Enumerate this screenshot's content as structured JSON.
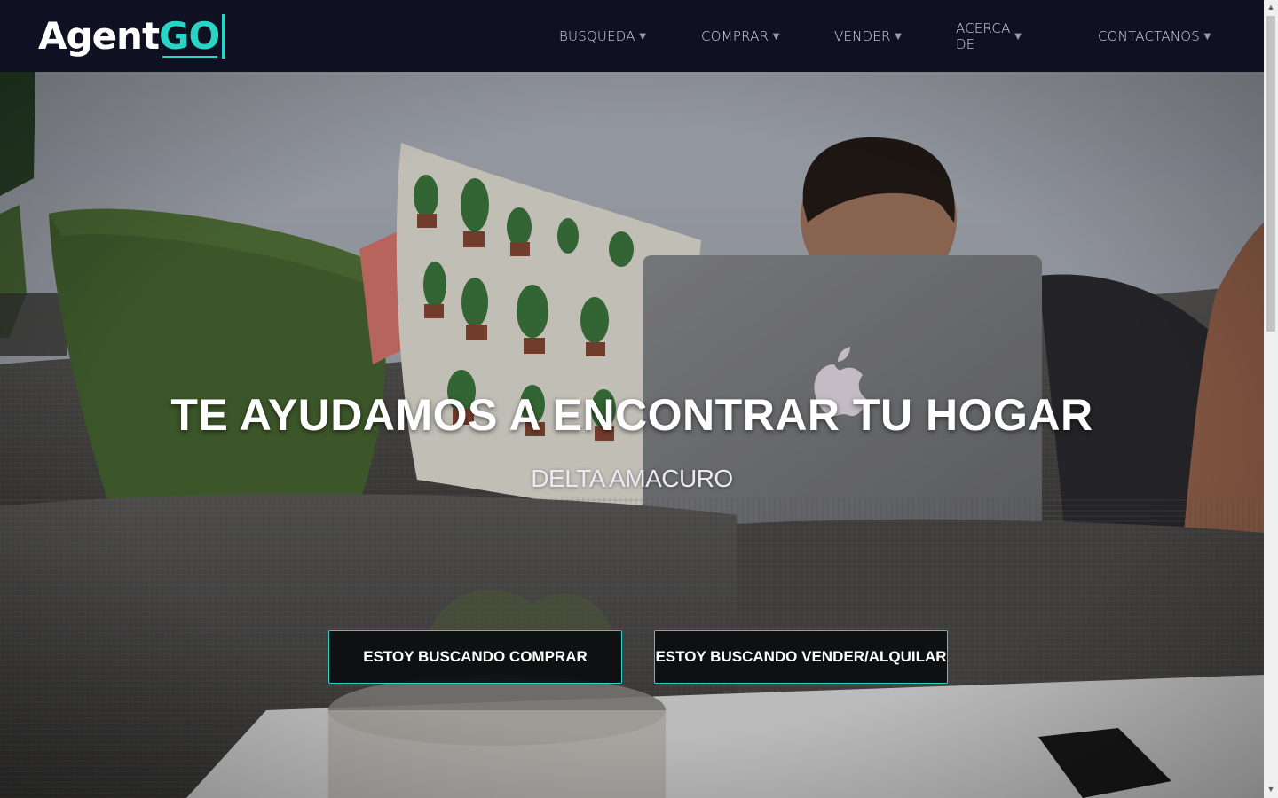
{
  "brand": {
    "name_primary": "Agent",
    "name_accent": "GO"
  },
  "nav": {
    "items": [
      {
        "label": "BUSQUEDA"
      },
      {
        "label": "COMPRAR"
      },
      {
        "label": "VENDER"
      },
      {
        "label": "ACERCA DE"
      },
      {
        "label": "CONTACTANOS"
      }
    ],
    "caret": "▼"
  },
  "hero": {
    "title": "TE AYUDAMOS A ENCONTRAR TU HOGAR",
    "subtitle": "DELTA AMACURO",
    "buttons": {
      "buy": "ESTOY BUSCANDO COMPRAR",
      "sell": "ESTOY BUSCANDO VENDER/ALQUILAR"
    }
  },
  "colors": {
    "accent": "#2ad4c4",
    "navbar": "#101023"
  }
}
